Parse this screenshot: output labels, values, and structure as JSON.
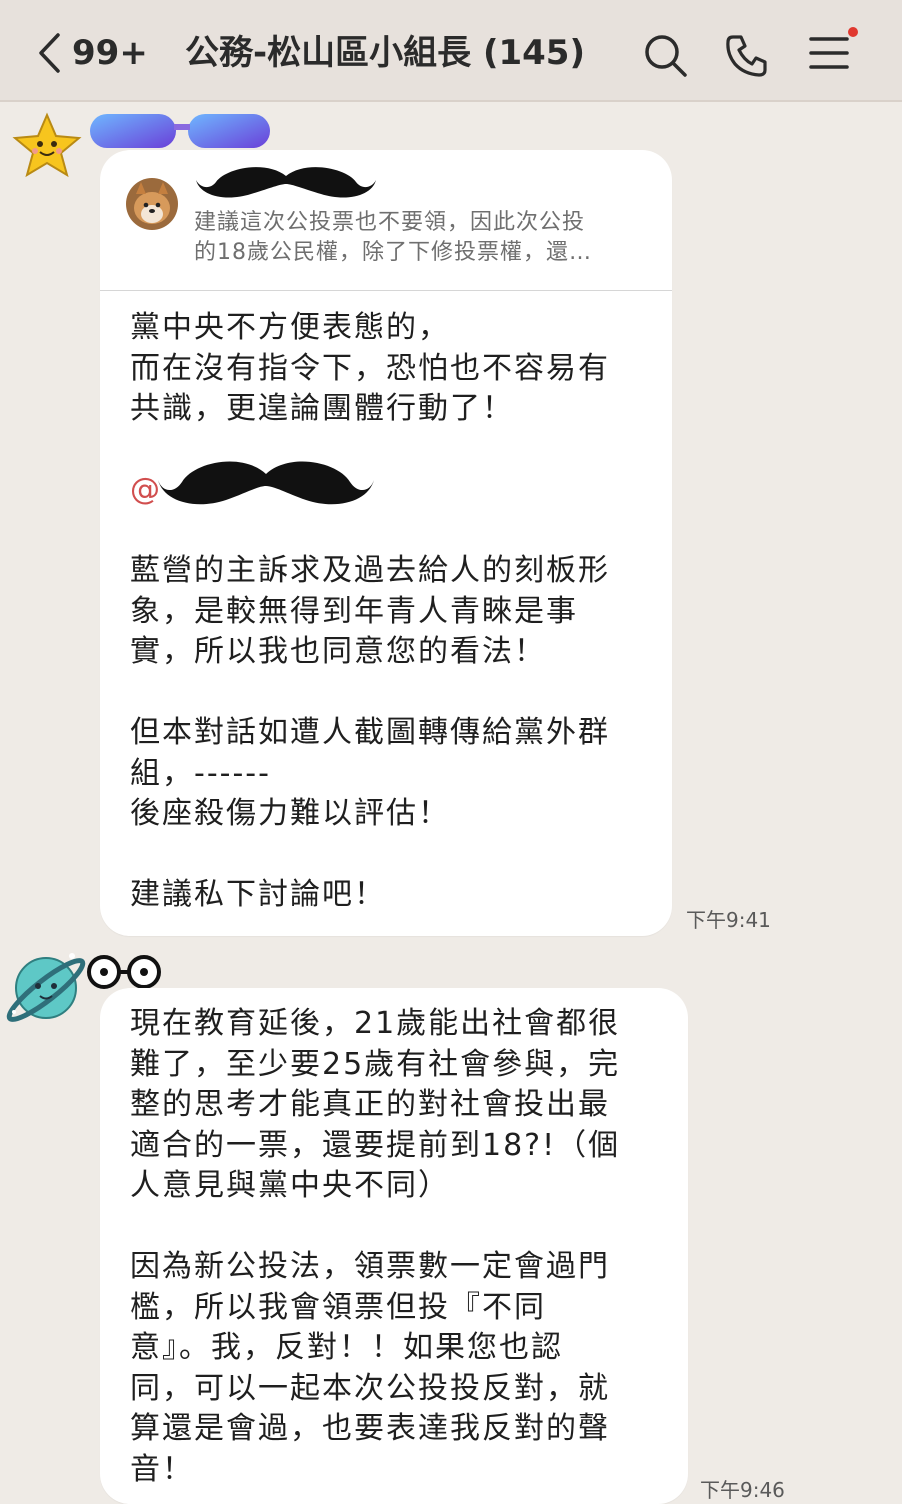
{
  "header": {
    "back_count": "99+",
    "title": "公務-松山區小組長 (145)",
    "icons": [
      "chevron-left-icon",
      "search-icon",
      "phone-icon",
      "menu-icon"
    ],
    "notification_color": "#e0382f"
  },
  "messages": [
    {
      "sender_avatar": "star-icon",
      "reply": {
        "preview_line1": "建議這次公投票也不要領，因此次公投",
        "preview_line2": "的18歲公民權，除了下修投票權，還…"
      },
      "text_block1": [
        "黨中央不方便表態的，",
        "而在沒有指令下，恐怕也不容易有",
        "共識，更遑論團體行動了！"
      ],
      "mention_prefix": "@",
      "text_block2": [
        "藍營的主訴求及過去給人的刻板形",
        "象，是較無得到年青人青睞是事",
        "實，所以我也同意您的看法！"
      ],
      "text_block3": [
        "但本對話如遭人截圖轉傳給黨外群",
        "組，------",
        "後座殺傷力難以評估！"
      ],
      "text_block4": [
        "建議私下討論吧！"
      ],
      "time": "下午9:41"
    },
    {
      "sender_avatar": "planet-icon",
      "text_block1": [
        "現在教育延後，21歲能出社會都很",
        "難了，至少要25歲有社會參與，完",
        "整的思考才能真正的對社會投出最",
        "適合的一票，還要提前到18?!（個",
        "人意見與黨中央不同）"
      ],
      "text_block2": [
        "因為新公投法，領票數一定會過門",
        "檻，所以我會領票但投『不同",
        "意』。我，反對！！如果您也認",
        "同，可以一起本次公投投反對，就",
        "算還是會過，也要表達我反對的聲",
        "音！"
      ],
      "time": "下午9:46"
    }
  ]
}
